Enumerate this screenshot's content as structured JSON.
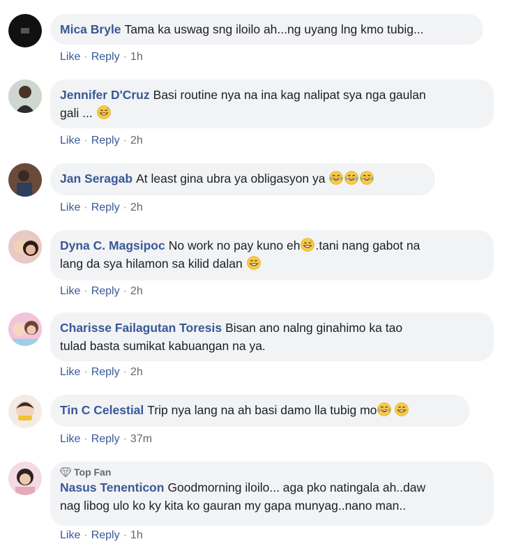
{
  "actions": {
    "like": "Like",
    "reply": "Reply",
    "separator": "·"
  },
  "comments": [
    {
      "name": "Mica Bryle",
      "text": "Tama ka uswag sng iloilo ah...ng uyang lng kmo tubig...",
      "time": "1h"
    },
    {
      "name": "Jennifer D'Cruz",
      "text_line1": "Basi routine nya na ina kag nalipat sya nga gaulan",
      "text_line2": "gali ... ",
      "time": "2h"
    },
    {
      "name": "Jan Seragab",
      "text": "At least gina ubra ya obligasyon ya ",
      "time": "2h"
    },
    {
      "name": "Dyna C. Magsipoc",
      "text_a": "No work no pay kuno eh",
      "text_b": ".tani nang gabot na",
      "text_line2": "lang da sya hilamon sa kilid dalan ",
      "time": "2h"
    },
    {
      "name": "Charisse Failagutan Toresis",
      "text_line1": "Bisan ano nalng ginahimo ka tao",
      "text_line2": "tulad basta sumikat kabuangan na ya.",
      "time": "2h"
    },
    {
      "name": "Tin C Celestial",
      "text": "Trip nya lang na ah basi damo lla tubig mo",
      "time": "37m"
    },
    {
      "badge": "Top Fan",
      "name": "Nasus Tenenticon",
      "text_line1": "Goodmorning iloilo... aga pko natingala ah..daw",
      "text_line2": "nag libog ulo ko ky kita ko gauran my gapa munyag..nano man..",
      "time": "1h"
    }
  ],
  "emoji_icons": [
    "grinning-sweat-emoji",
    "tears-of-joy-emoji",
    "grin-emoji"
  ]
}
